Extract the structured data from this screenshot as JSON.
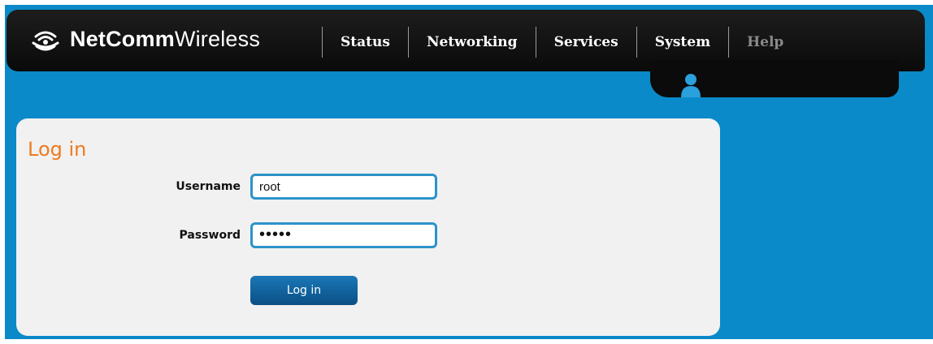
{
  "brand": {
    "name_bold": "NetComm",
    "name_regular": "Wireless",
    "icon": "wifi-signal-icon"
  },
  "nav": {
    "items": [
      {
        "label": "Status"
      },
      {
        "label": "Networking"
      },
      {
        "label": "Services"
      },
      {
        "label": "System"
      },
      {
        "label": "Help"
      }
    ]
  },
  "user": {
    "icon": "user-icon"
  },
  "login": {
    "title": "Log in",
    "username_label": "Username",
    "username_value": "root",
    "password_label": "Password",
    "password_value": "•••••",
    "button_label": "Log in"
  },
  "colors": {
    "background": "#0a8ac8",
    "header": "#111111",
    "title_accent": "#ee7a1f",
    "field_border": "#2c93c9",
    "button": "#0b5f9b"
  }
}
